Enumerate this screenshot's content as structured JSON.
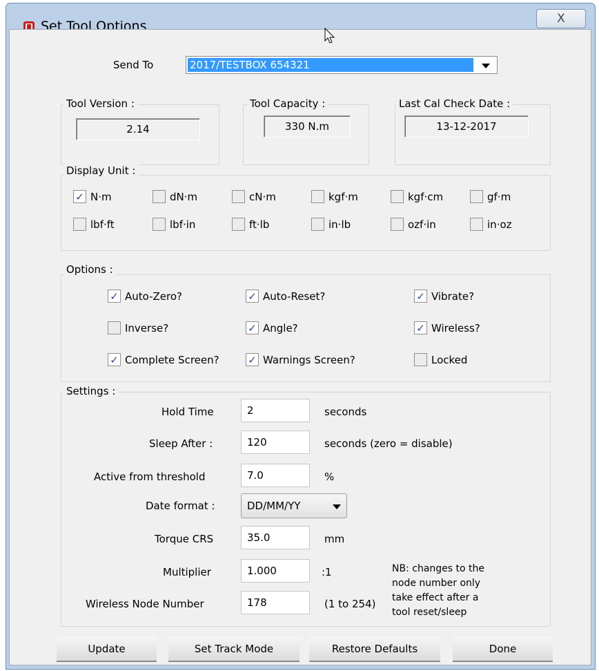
{
  "window": {
    "title": "Set Tool Options",
    "close_symbol": "X"
  },
  "send_to": {
    "label": "Send To",
    "selected_value": "2017/TESTBOX   654321"
  },
  "tool_version": {
    "label": "Tool Version :",
    "value": "2.14"
  },
  "tool_capacity": {
    "label": "Tool Capacity :",
    "value": "330 N.m"
  },
  "last_cal": {
    "label": "Last Cal Check Date :",
    "value": "13-12-2017"
  },
  "display_unit": {
    "label": "Display Unit :",
    "units": [
      {
        "label": "N·m",
        "checked": true
      },
      {
        "label": "dN·m",
        "checked": false
      },
      {
        "label": "cN·m",
        "checked": false
      },
      {
        "label": "kgf·m",
        "checked": false
      },
      {
        "label": "kgf·cm",
        "checked": false
      },
      {
        "label": "gf·m",
        "checked": false
      },
      {
        "label": "lbf·ft",
        "checked": false
      },
      {
        "label": "lbf·in",
        "checked": false
      },
      {
        "label": "ft·lb",
        "checked": false
      },
      {
        "label": "in·lb",
        "checked": false
      },
      {
        "label": "ozf·in",
        "checked": false
      },
      {
        "label": "in·oz",
        "checked": false
      }
    ]
  },
  "options": {
    "label": "Options :",
    "items": [
      {
        "label": "Auto-Zero?",
        "checked": true
      },
      {
        "label": "Auto-Reset?",
        "checked": true
      },
      {
        "label": "Vibrate?",
        "checked": true
      },
      {
        "label": "Inverse?",
        "checked": false
      },
      {
        "label": "Angle?",
        "checked": true
      },
      {
        "label": "Wireless?",
        "checked": true
      },
      {
        "label": "Complete Screen?",
        "checked": true
      },
      {
        "label": "Warnings Screen?",
        "checked": true
      },
      {
        "label": "Locked",
        "checked": false
      }
    ]
  },
  "settings": {
    "label": "Settings :",
    "hold_time": {
      "label": "Hold Time",
      "value": "2",
      "unit": "seconds"
    },
    "sleep_after": {
      "label": "Sleep After :",
      "value": "120",
      "unit": "seconds (zero = disable)"
    },
    "active_threshold": {
      "label": "Active from threshold",
      "value": "7.0",
      "unit": "%"
    },
    "date_format": {
      "label": "Date format :",
      "value": "DD/MM/YY"
    },
    "torque_crs": {
      "label": "Torque CRS",
      "value": "35.0",
      "unit": "mm"
    },
    "multiplier": {
      "label": "Multiplier",
      "value": "1.000",
      "unit": ":1"
    },
    "wireless_node": {
      "label": "Wireless Node Number",
      "value": "178",
      "unit": "(1 to 254)"
    },
    "note_lines": [
      "NB: changes to the",
      "node number only",
      "take effect after a",
      "tool reset/sleep"
    ]
  },
  "buttons": {
    "update": "Update",
    "set_track_mode": "Set Track Mode",
    "restore_defaults": "Restore Defaults",
    "done": "Done"
  },
  "checkmark": "✓"
}
